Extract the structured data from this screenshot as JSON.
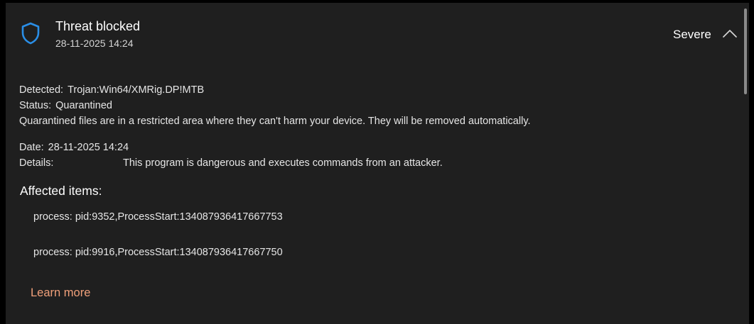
{
  "header": {
    "title": "Threat blocked",
    "timestamp": "28-11-2025 14:24",
    "severity": "Severe",
    "shield_icon": "shield-icon",
    "chevron_icon": "chevron-up-icon",
    "shield_color": "#2a8ee6"
  },
  "info": {
    "detected_label": "Detected:",
    "detected_value": "Trojan:Win64/XMRig.DP!MTB",
    "status_label": "Status:",
    "status_value": "Quarantined",
    "quarantine_note": "Quarantined files are in a restricted area where they can't harm your device. They will be removed automatically.",
    "date_label": "Date:",
    "date_value": "28-11-2025 14:24",
    "details_label": "Details:",
    "details_value": "This program is dangerous and executes commands from an attacker."
  },
  "affected": {
    "title": "Affected items:",
    "items": [
      "process: pid:9352,ProcessStart:134087936417667753",
      "process: pid:9916,ProcessStart:134087936417667750"
    ]
  },
  "links": {
    "learn_more": "Learn more",
    "link_color": "#f0a07a"
  }
}
